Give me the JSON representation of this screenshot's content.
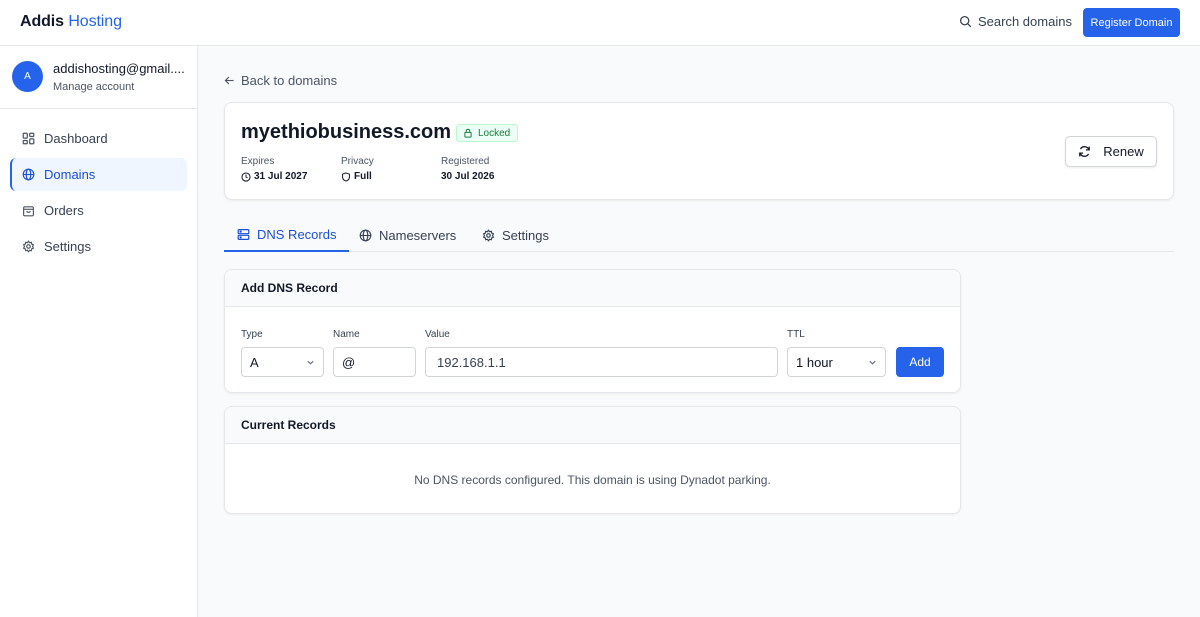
{
  "header": {
    "brand_main": "Addis",
    "brand_accent": "Hosting",
    "search_label": "Search domains",
    "register_label": "Register Domain"
  },
  "sidebar": {
    "account": {
      "avatar_initial": "A",
      "email": "addishosting@gmail....",
      "manage_label": "Manage account"
    },
    "items": [
      {
        "label": "Dashboard",
        "icon": "grid-icon"
      },
      {
        "label": "Domains",
        "icon": "globe-icon",
        "active": true
      },
      {
        "label": "Orders",
        "icon": "bag-icon"
      },
      {
        "label": "Settings",
        "icon": "gear-icon"
      }
    ]
  },
  "main": {
    "back_label": "Back to domains",
    "domain": {
      "name": "myethiobusiness.com",
      "status_badge": "Locked",
      "expires_label": "Expires",
      "expires_value": "31 Jul 2027",
      "privacy_label": "Privacy",
      "privacy_value": "Full",
      "registered_label": "Registered",
      "registered_value": "30 Jul 2026",
      "renew_label": "Renew"
    },
    "tabs": [
      {
        "label": "DNS Records",
        "icon": "server-icon",
        "active": true
      },
      {
        "label": "Nameservers",
        "icon": "globe-icon"
      },
      {
        "label": "Settings",
        "icon": "gear-icon"
      }
    ],
    "add_record": {
      "title": "Add DNS Record",
      "type_label": "Type",
      "type_value": "A",
      "name_label": "Name",
      "name_value": "@",
      "value_label": "Value",
      "value_value": "192.168.1.1",
      "ttl_label": "TTL",
      "ttl_value": "1 hour",
      "add_label": "Add"
    },
    "current_records": {
      "title": "Current Records",
      "empty_message": "No DNS records configured. This domain is using Dynadot parking."
    }
  },
  "colors": {
    "accent": "#2563eb",
    "success": "#15803d",
    "border": "#e5e7eb"
  }
}
